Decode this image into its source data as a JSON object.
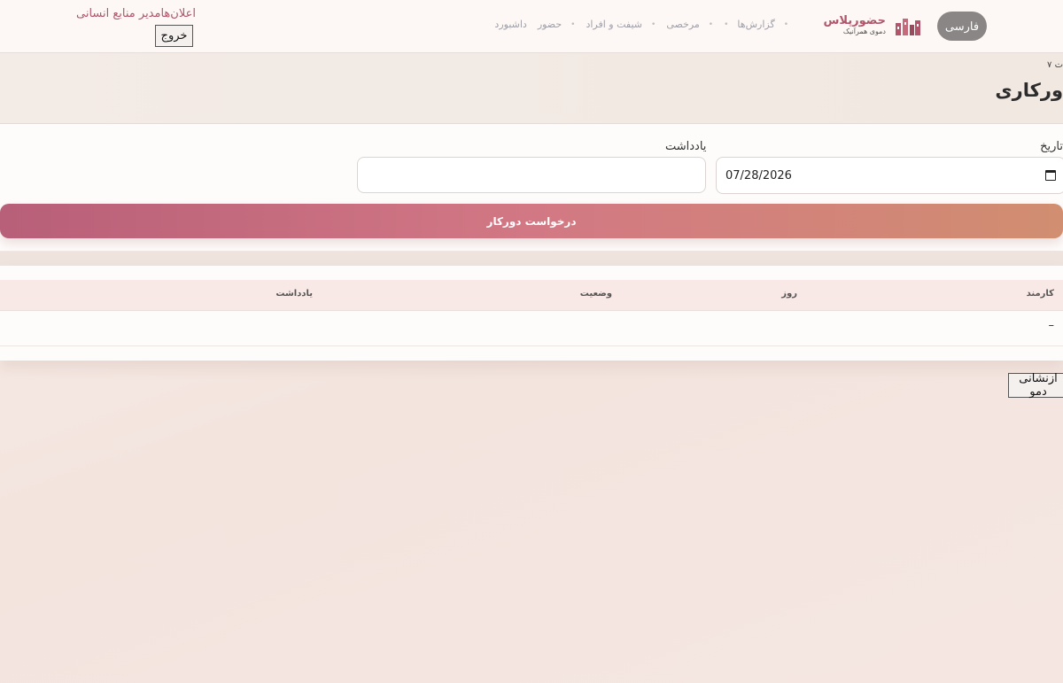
{
  "header": {
    "language_button": "فارسی",
    "brand_name": "حضورپلاس",
    "brand_subtitle": "دموی همرآنیک",
    "nav_items": [
      "داشبورد",
      "حضور",
      "شیفت و افراد",
      "مرخصی",
      "گزارش‌ها"
    ],
    "user_label": "اعلان‌هامدیر منابع انسانی",
    "logout_button": "خروج"
  },
  "page": {
    "breadcrumb": "ت ۷",
    "title": "ورکاری"
  },
  "form": {
    "date_label": "تاریخ",
    "date_value": "07/28/2026",
    "note_label": "یادداشت",
    "note_value": "",
    "submit_button": "درخواست دورکار"
  },
  "table": {
    "columns": [
      "کارمند",
      "روز",
      "وضعیت",
      "یادداشت"
    ],
    "empty_cell": "–"
  },
  "reset_button": "ازنشانی دمو",
  "colors": {
    "accent": "#b0556a",
    "button_gradient_start": "#b85f79",
    "button_gradient_end": "#d18e70"
  }
}
